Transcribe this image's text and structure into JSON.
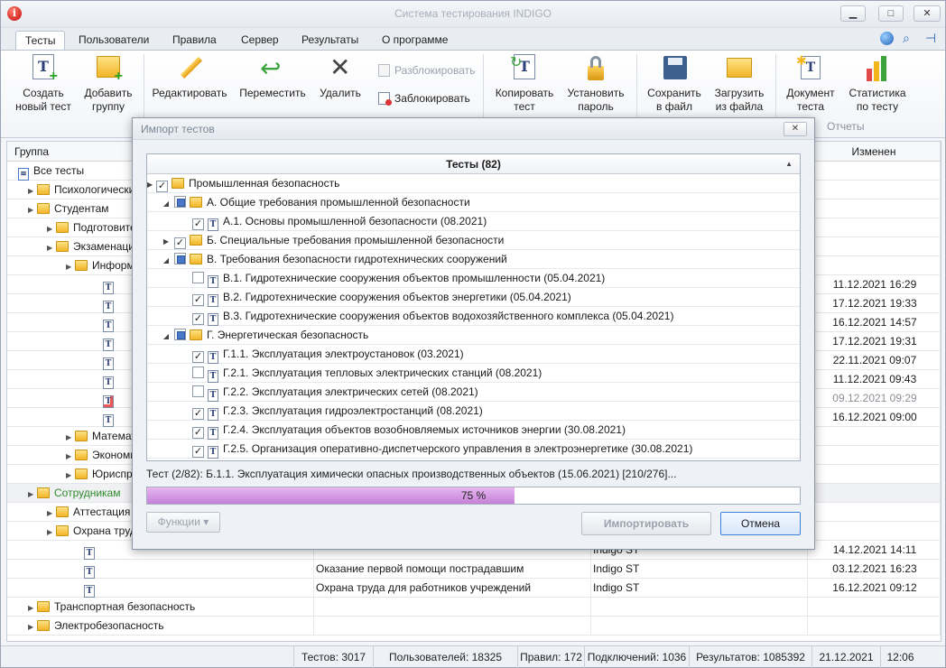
{
  "window": {
    "title": "Система тестирования INDIGO",
    "min": "▁",
    "max": "□",
    "close": "✕"
  },
  "menu_tabs": [
    "Тесты",
    "Пользователи",
    "Правила",
    "Сервер",
    "Результаты",
    "О программе"
  ],
  "ribbon": {
    "create": [
      "Создать",
      "новый тест"
    ],
    "add_group": [
      "Добавить",
      "группу"
    ],
    "edit": "Редактировать",
    "move": "Переместить",
    "delete": "Удалить",
    "unlock": "Разблокировать",
    "lock": "Заблокировать",
    "copy": [
      "Копировать",
      "тест"
    ],
    "set_password": [
      "Установить",
      "пароль"
    ],
    "save_file": [
      "Сохранить",
      "в файл"
    ],
    "load_file": [
      "Загрузить",
      "из файла"
    ],
    "test_doc": [
      "Документ",
      "теста"
    ],
    "test_stats": [
      "Статистика",
      "по тесту"
    ],
    "reports_label": "Отчеты"
  },
  "grid": {
    "header_group": "Группа",
    "header_changed": "Изменен",
    "rows": [
      {
        "label": "Все тесты",
        "type": "all",
        "indent": 0
      },
      {
        "label": "Психологические",
        "type": "folder",
        "indent": 1
      },
      {
        "label": "Студентам",
        "type": "folder",
        "indent": 1
      },
      {
        "label": "Подготовительные",
        "type": "folder",
        "indent": 2
      },
      {
        "label": "Экзаменационные",
        "type": "folder",
        "indent": 2
      },
      {
        "label": "Информатика",
        "type": "folder",
        "indent": 3
      },
      {
        "label": "",
        "type": "doc",
        "indent": 4,
        "changed": "11.12.2021 16:29"
      },
      {
        "label": "",
        "type": "doc",
        "indent": 4,
        "changed": "17.12.2021 19:33"
      },
      {
        "label": "",
        "type": "doc",
        "indent": 4,
        "changed": "16.12.2021 14:57"
      },
      {
        "label": "",
        "type": "doc",
        "indent": 4,
        "changed": "17.12.2021 19:31"
      },
      {
        "label": "",
        "type": "doc",
        "indent": 4,
        "changed": "22.11.2021 09:07"
      },
      {
        "label": "",
        "type": "doc",
        "indent": 4,
        "changed": "11.12.2021 09:43"
      },
      {
        "label": "",
        "type": "doc-locked",
        "indent": 4,
        "changed": "09.12.2021 09:29"
      },
      {
        "label": "",
        "type": "doc",
        "indent": 4,
        "changed": "16.12.2021 09:00"
      },
      {
        "label": "Математика",
        "type": "folder",
        "indent": 3
      },
      {
        "label": "Экономика",
        "type": "folder",
        "indent": 3
      },
      {
        "label": "Юриспруденция",
        "type": "folder",
        "indent": 3
      },
      {
        "label": "Сотрудникам",
        "type": "folder-green",
        "indent": 1
      },
      {
        "label": "Аттестация",
        "type": "folder",
        "indent": 2
      },
      {
        "label": "Охрана труда",
        "type": "folder",
        "indent": 2
      },
      {
        "label": "",
        "type": "doc",
        "indent": 3,
        "name": "",
        "author": "Indigo ST",
        "changed": "14.12.2021 14:11"
      },
      {
        "label": "",
        "type": "doc",
        "indent": 3,
        "name": "Оказание первой помощи пострадавшим",
        "author": "Indigo ST",
        "changed": "03.12.2021 16:23"
      },
      {
        "label": "",
        "type": "doc",
        "indent": 3,
        "name": "Охрана труда для работников учреждений",
        "author": "Indigo ST",
        "changed": "16.12.2021 09:12"
      },
      {
        "label": "Транспортная безопасность",
        "type": "folder",
        "indent": 1
      },
      {
        "label": "Электробезопасность",
        "type": "folder",
        "indent": 1
      }
    ]
  },
  "status": {
    "tests": "Тестов: 3017",
    "users": "Пользователей: 18325",
    "rules": "Правил: 172",
    "connections": "Подключений: 1036",
    "results": "Результатов: 1085392",
    "date": "21.12.2021",
    "time": "12:06"
  },
  "dialog": {
    "title": "Импорт тестов",
    "close": "✕",
    "tree_header": "Тесты (82)",
    "items": [
      {
        "label": "Промышленная безопасность",
        "level": 0,
        "check": "checked",
        "expander": "▶",
        "kind": "folder"
      },
      {
        "label": "А. Общие требования промышленной безопасности",
        "level": 1,
        "check": "partial",
        "expander": "◢",
        "kind": "folder"
      },
      {
        "label": "А.1. Основы промышленной безопасности (08.2021)",
        "level": 2,
        "check": "checked",
        "expander": "",
        "kind": "doc"
      },
      {
        "label": "Б. Специальные требования промышленной безопасности",
        "level": 1,
        "check": "checked",
        "expander": "▶",
        "kind": "folder"
      },
      {
        "label": "В. Требования безопасности гидротехнических сооружений",
        "level": 1,
        "check": "partial",
        "expander": "◢",
        "kind": "folder"
      },
      {
        "label": "В.1. Гидротехнические сооружения объектов промышленности (05.04.2021)",
        "level": 2,
        "check": "unchecked",
        "expander": "",
        "kind": "doc"
      },
      {
        "label": "В.2. Гидротехнические сооружения объектов энергетики (05.04.2021)",
        "level": 2,
        "check": "checked",
        "expander": "",
        "kind": "doc"
      },
      {
        "label": "В.3. Гидротехнические сооружения объектов водохозяйственного комплекса (05.04.2021)",
        "level": 2,
        "check": "checked",
        "expander": "",
        "kind": "doc"
      },
      {
        "label": "Г. Энергетическая безопасность",
        "level": 1,
        "check": "partial",
        "expander": "◢",
        "kind": "folder"
      },
      {
        "label": "Г.1.1. Эксплуатация электроустановок (03.2021)",
        "level": 2,
        "check": "checked",
        "expander": "",
        "kind": "doc"
      },
      {
        "label": "Г.2.1. Эксплуатация тепловых электрических станций (08.2021)",
        "level": 2,
        "check": "unchecked",
        "expander": "",
        "kind": "doc"
      },
      {
        "label": "Г.2.2. Эксплуатация электрических сетей (08.2021)",
        "level": 2,
        "check": "unchecked",
        "expander": "",
        "kind": "doc"
      },
      {
        "label": "Г.2.3. Эксплуатация гидроэлектростанций (08.2021)",
        "level": 2,
        "check": "checked",
        "expander": "",
        "kind": "doc"
      },
      {
        "label": "Г.2.4. Эксплуатация объектов возобновляемых источников энергии (30.08.2021)",
        "level": 2,
        "check": "checked",
        "expander": "",
        "kind": "doc"
      },
      {
        "label": "Г.2.5. Организация оперативно-диспетчерского управления в электроэнергетике (30.08.2021)",
        "level": 2,
        "check": "checked",
        "expander": "",
        "kind": "doc"
      }
    ],
    "status_line": "Тест (2/82): Б.1.1. Эксплуатация химически опасных производственных объектов (15.06.2021) [210/276]...",
    "progress_percent": 75,
    "progress_text": "75 %",
    "functions_btn": "Функции ▾",
    "import_btn": "Импортировать",
    "cancel_btn": "Отмена"
  }
}
